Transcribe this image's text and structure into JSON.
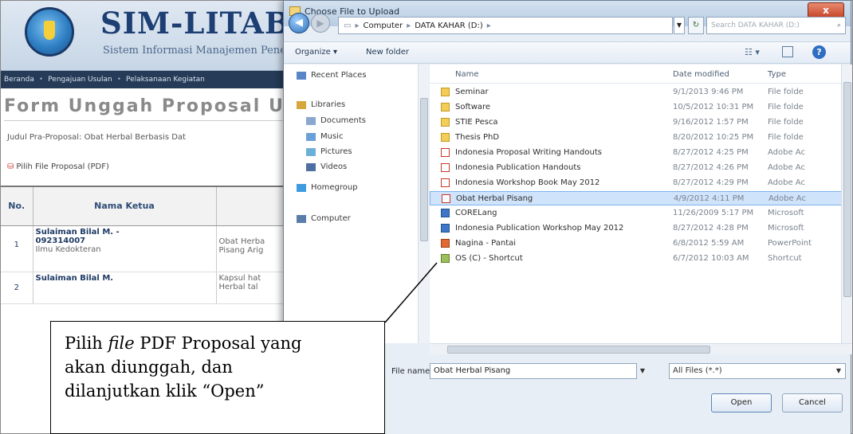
{
  "app": {
    "title": "SIM-LITABMAS",
    "subtitle": "Sistem Informasi Manajemen Pene",
    "menu": [
      "Beranda",
      "Pengajuan Usulan",
      "Pelaksanaan Kegiatan"
    ],
    "form_title": "Form Unggah Proposal Usu",
    "judul_label": "Judul Pra-Proposal: Obat Herbal Berbasis Dat",
    "pilih_file_label": "Pilih File Proposal (PDF)",
    "table": {
      "headers": [
        "No.",
        "Nama Ketua",
        ""
      ],
      "rows": [
        {
          "no": "1",
          "nama": "Sulaiman Bilal M. -",
          "nip": "092314007",
          "sub": "Ilmu Kedokteran",
          "judul1": "Obat Herba",
          "judul2": "Pisang Arig"
        },
        {
          "no": "2",
          "nama": "Sulaiman Bilal M.",
          "nip": "",
          "sub": "",
          "judul1": "Kapsul hat",
          "judul2": "Herbal tal"
        }
      ]
    }
  },
  "dialog": {
    "title": "Choose File to Upload",
    "close_label": "x",
    "address": {
      "segments": [
        "Computer",
        "DATA KAHAR (D:)"
      ]
    },
    "search_placeholder": "Search DATA KAHAR (D:)",
    "toolbar": {
      "organize": "Organize ▾",
      "new_folder": "New folder"
    },
    "nav": [
      {
        "label": "Recent Places",
        "icon": "recent-places-icon"
      },
      {
        "label": "Libraries",
        "icon": "libraries-icon"
      },
      {
        "label": "Documents",
        "icon": "documents-icon"
      },
      {
        "label": "Music",
        "icon": "music-icon"
      },
      {
        "label": "Pictures",
        "icon": "pictures-icon"
      },
      {
        "label": "Videos",
        "icon": "videos-icon"
      },
      {
        "label": "Homegroup",
        "icon": "homegroup-icon"
      },
      {
        "label": "Computer",
        "icon": "computer-icon"
      }
    ],
    "columns": {
      "name": "Name",
      "date": "Date modified",
      "type": "Type"
    },
    "files": [
      {
        "name": "Seminar",
        "date": "9/1/2013 9:46 PM",
        "type": "File folde",
        "kind": "folder"
      },
      {
        "name": "Software",
        "date": "10/5/2012 10:31 PM",
        "type": "File folde",
        "kind": "folder"
      },
      {
        "name": "STIE Pesca",
        "date": "9/16/2012 1:57 PM",
        "type": "File folde",
        "kind": "folder"
      },
      {
        "name": "Thesis PhD",
        "date": "8/20/2012 10:25 PM",
        "type": "File folde",
        "kind": "folder"
      },
      {
        "name": "Indonesia Proposal Writing Handouts",
        "date": "8/27/2012 4:25 PM",
        "type": "Adobe Ac",
        "kind": "pdf"
      },
      {
        "name": "Indonesia Publication Handouts",
        "date": "8/27/2012 4:26 PM",
        "type": "Adobe Ac",
        "kind": "pdf"
      },
      {
        "name": "Indonesia Workshop Book May 2012",
        "date": "8/27/2012 4:29 PM",
        "type": "Adobe Ac",
        "kind": "pdf"
      },
      {
        "name": "Obat Herbal Pisang",
        "date": "4/9/2012 4:11 PM",
        "type": "Adobe Ac",
        "kind": "pdf",
        "selected": true
      },
      {
        "name": "CORELang",
        "date": "11/26/2009 5:17 PM",
        "type": "Microsoft",
        "kind": "word"
      },
      {
        "name": "Indonesia Publication Workshop May 2012",
        "date": "8/27/2012 4:28 PM",
        "type": "Microsoft",
        "kind": "word"
      },
      {
        "name": "Nagina - Pantai",
        "date": "6/8/2012 5:59 AM",
        "type": "PowerPoint",
        "kind": "ppt"
      },
      {
        "name": "OS (C) - Shortcut",
        "date": "6/7/2012 10:03 AM",
        "type": "Shortcut",
        "kind": "app"
      }
    ],
    "file_name_label": "File name:",
    "file_name_value": "Obat Herbal Pisang",
    "file_type": "All Files (*.*)",
    "open_label": "Open",
    "cancel_label": "Cancel"
  },
  "callout": {
    "line1_pre": "Pilih ",
    "line1_em": "file",
    "line1_post": " PDF Proposal yang",
    "line2": "akan diunggah, dan",
    "line3": "dilanjutkan klik “Open”"
  }
}
